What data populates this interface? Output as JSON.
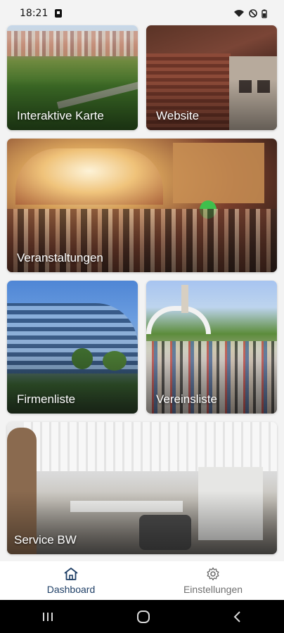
{
  "status_bar": {
    "time": "18:21"
  },
  "tiles": [
    {
      "label": "Interaktive Karte"
    },
    {
      "label": "Website"
    },
    {
      "label": "Veranstaltungen"
    },
    {
      "label": "Firmenliste"
    },
    {
      "label": "Vereinsliste"
    },
    {
      "label": "Service BW"
    }
  ],
  "bottom_nav": {
    "dashboard_label": "Dashboard",
    "settings_label": "Einstellungen",
    "active_color": "#1f3f66",
    "inactive_color": "#6f6f6f"
  },
  "icons": {
    "home": "home-icon",
    "settings": "gear-icon",
    "recent_apps": "recent-apps-icon",
    "home_button": "home-button-icon",
    "back": "back-icon"
  }
}
